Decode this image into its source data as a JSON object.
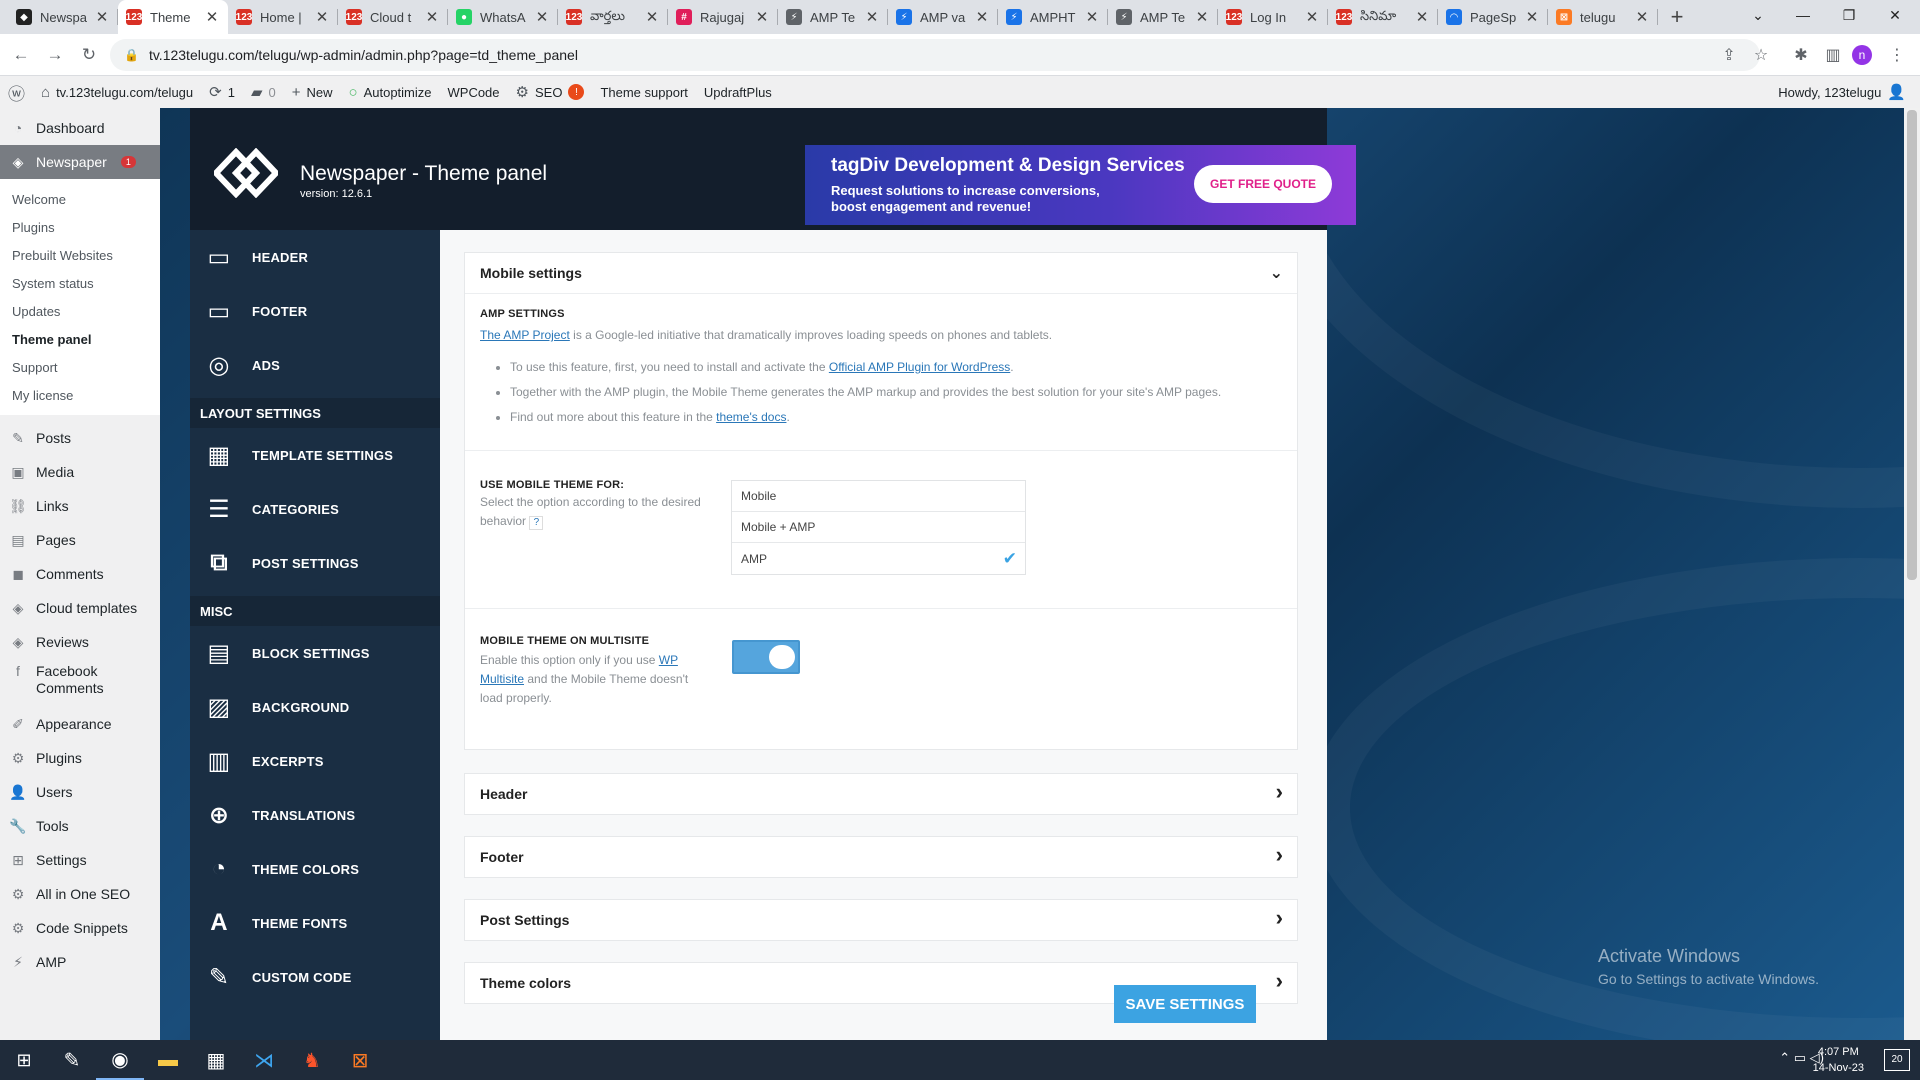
{
  "browser": {
    "tabs": [
      {
        "title": "Newspa",
        "icon": "tagdiv-icon",
        "color": "#222222",
        "glyph": "◆"
      },
      {
        "title": "Theme",
        "icon": "site-123-icon",
        "color": "#d93025",
        "glyph": "123",
        "active": true
      },
      {
        "title": "Home |",
        "icon": "site-123-icon",
        "color": "#d93025",
        "glyph": "123"
      },
      {
        "title": "Cloud t",
        "icon": "site-123-icon",
        "color": "#d93025",
        "glyph": "123"
      },
      {
        "title": "WhatsA",
        "icon": "whatsapp-icon",
        "color": "#25d366",
        "glyph": "●"
      },
      {
        "title": "వార్తలు",
        "icon": "site-123-icon",
        "color": "#d93025",
        "glyph": "123"
      },
      {
        "title": "Rajugaj",
        "icon": "slack-icon",
        "color": "#e01e5a",
        "glyph": "#"
      },
      {
        "title": "AMP Te",
        "icon": "amp-icon",
        "color": "#5f6368",
        "glyph": "⚡"
      },
      {
        "title": "AMP va",
        "icon": "amp-validator-icon",
        "color": "#1a73e8",
        "glyph": "⚡"
      },
      {
        "title": "AMPHT",
        "icon": "amp-validator-icon",
        "color": "#1a73e8",
        "glyph": "⚡"
      },
      {
        "title": "AMP Te",
        "icon": "amp-icon",
        "color": "#5f6368",
        "glyph": "⚡"
      },
      {
        "title": "Log In",
        "icon": "site-123-icon",
        "color": "#d93025",
        "glyph": "123"
      },
      {
        "title": "సినిమా",
        "icon": "site-123-icon",
        "color": "#d93025",
        "glyph": "123"
      },
      {
        "title": "PageSp",
        "icon": "pagespeed-icon",
        "color": "#1a73e8",
        "glyph": "◠"
      },
      {
        "title": "telugu",
        "icon": "xampp-icon",
        "color": "#fb7a24",
        "glyph": "⊠"
      }
    ],
    "url": "tv.123telugu.com/telugu/wp-admin/admin.php?page=td_theme_panel"
  },
  "adminbar": {
    "site": "tv.123telugu.com/telugu",
    "updates": "1",
    "comments": "0",
    "new": "New",
    "autoptimize": "Autoptimize",
    "wpcode": "WPCode",
    "seo": "SEO",
    "seo_badge": "!",
    "theme_support": "Theme support",
    "updraft": "UpdraftPlus",
    "howdy": "Howdy, 123telugu"
  },
  "wpmenu": {
    "dashboard": "Dashboard",
    "newspaper": "Newspaper",
    "newspaper_badge": "1",
    "submenu": [
      "Welcome",
      "Plugins",
      "Prebuilt Websites",
      "System status",
      "Updates",
      "Theme panel",
      "Support",
      "My license"
    ],
    "items": [
      {
        "label": "Posts",
        "icon": "pin-icon",
        "glyph": "✎"
      },
      {
        "label": "Media",
        "icon": "media-icon",
        "glyph": "▣"
      },
      {
        "label": "Links",
        "icon": "link-icon",
        "glyph": "⛓"
      },
      {
        "label": "Pages",
        "icon": "pages-icon",
        "glyph": "▤"
      },
      {
        "label": "Comments",
        "icon": "comment-icon",
        "glyph": "◼"
      },
      {
        "label": "Cloud templates",
        "icon": "cloud-templates-icon",
        "glyph": "◈"
      },
      {
        "label": "Reviews",
        "icon": "reviews-icon",
        "glyph": "◈"
      },
      {
        "label": "Facebook Comments",
        "icon": "facebook-icon",
        "glyph": "f"
      }
    ],
    "items2": [
      {
        "label": "Appearance",
        "icon": "brush-icon",
        "glyph": "✐"
      },
      {
        "label": "Plugins",
        "icon": "plugin-icon",
        "glyph": "⚙"
      },
      {
        "label": "Users",
        "icon": "user-icon",
        "glyph": "👤"
      },
      {
        "label": "Tools",
        "icon": "wrench-icon",
        "glyph": "🔧"
      },
      {
        "label": "Settings",
        "icon": "settings-icon",
        "glyph": "⊞"
      },
      {
        "label": "All in One SEO",
        "icon": "aioseo-icon",
        "glyph": "⚙"
      },
      {
        "label": "Code Snippets",
        "icon": "snippets-icon",
        "glyph": "⚙"
      },
      {
        "label": "AMP",
        "icon": "amp-icon",
        "glyph": "⚡"
      }
    ]
  },
  "panel": {
    "title": "Newspaper - Theme panel",
    "version": "version: 12.6.1",
    "banner_title": "tagDiv Development & Design Services",
    "banner_sub1": "Request solutions to increase conversions,",
    "banner_sub2": "boost engagement and revenue!",
    "banner_cta": "GET FREE QUOTE"
  },
  "tdnav": {
    "top": [
      {
        "label": "HEADER",
        "icon": "header-icon",
        "glyph": "▭"
      },
      {
        "label": "FOOTER",
        "icon": "footer-icon",
        "glyph": "▭"
      },
      {
        "label": "ADS",
        "icon": "target-icon",
        "glyph": "◎"
      }
    ],
    "layout_title": "LAYOUT SETTINGS",
    "layout": [
      {
        "label": "TEMPLATE SETTINGS",
        "icon": "template-icon",
        "glyph": "▦"
      },
      {
        "label": "CATEGORIES",
        "icon": "list-icon",
        "glyph": "☰"
      },
      {
        "label": "POST SETTINGS",
        "icon": "post-settings-icon",
        "glyph": "⧉"
      }
    ],
    "misc_title": "MISC",
    "misc": [
      {
        "label": "BLOCK SETTINGS",
        "icon": "block-icon",
        "glyph": "▤"
      },
      {
        "label": "BACKGROUND",
        "icon": "image-icon",
        "glyph": "▨"
      },
      {
        "label": "EXCERPTS",
        "icon": "excerpt-icon",
        "glyph": "▥"
      },
      {
        "label": "TRANSLATIONS",
        "icon": "globe-icon",
        "glyph": "⊕"
      },
      {
        "label": "THEME COLORS",
        "icon": "palette-icon",
        "glyph": "◔"
      },
      {
        "label": "THEME FONTS",
        "icon": "font-icon",
        "glyph": "A"
      },
      {
        "label": "CUSTOM CODE",
        "icon": "code-icon",
        "glyph": "✎"
      }
    ]
  },
  "mobile": {
    "heading": "Mobile settings",
    "amp_label": "AMP SETTINGS",
    "amp_link": "The AMP Project",
    "amp_text": " is a Google-led initiative that dramatically improves loading speeds on phones and tablets.",
    "bullet1_pre": "To use this feature, first, you need to install and activate the ",
    "bullet1_link": "Official AMP Plugin for WordPress",
    "bullet2": "Together with the AMP plugin, the Mobile Theme generates the AMP markup and provides the best solution for your site's AMP pages.",
    "bullet3_pre": "Find out more about this feature in the ",
    "bullet3_link": "theme's docs",
    "use_label": "USE MOBILE THEME FOR:",
    "use_desc": "Select the option according to the desired behavior",
    "help": "?",
    "options": [
      "Mobile",
      "Mobile + AMP",
      "AMP"
    ],
    "selected": "AMP",
    "multisite_label": "MOBILE THEME ON MULTISITE",
    "ms_pre": "Enable this option only if you use ",
    "ms_link1": "WP",
    "ms_link2": "Multisite",
    "ms_post": " and the Mobile Theme doesn't load properly.",
    "toggle_on": true
  },
  "sections": [
    "Header",
    "Footer",
    "Post Settings",
    "Theme colors"
  ],
  "save_label": "SAVE SETTINGS",
  "watermark": {
    "line1": "Activate Windows",
    "line2": "Go to Settings to activate Windows."
  },
  "clock": {
    "time": "4:07 PM",
    "date": "14-Nov-23"
  },
  "notification_count": "20",
  "colors": {
    "accent": "#3ca3e2",
    "panel_bg": "#131e2c",
    "nav_bg": "#1a2e43"
  }
}
